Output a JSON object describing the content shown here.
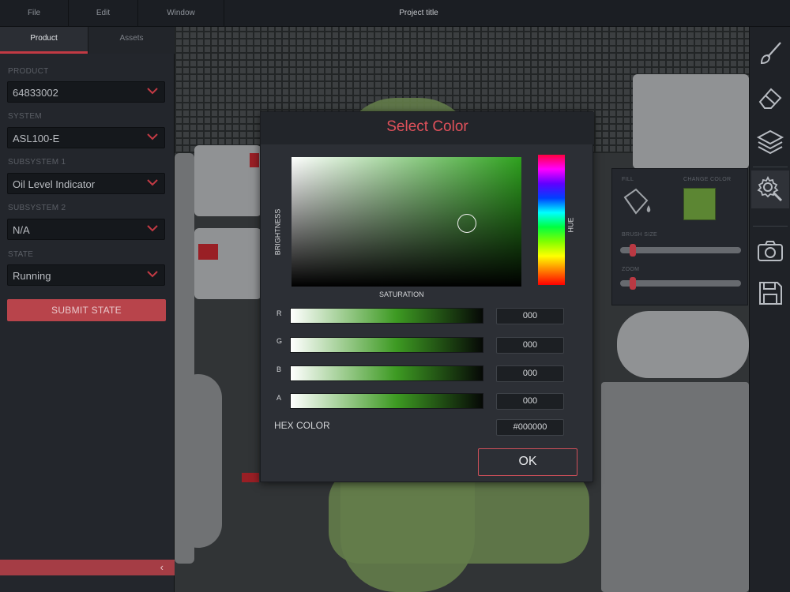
{
  "menubar": {
    "items": [
      "File",
      "Edit",
      "Window"
    ],
    "project_title": "Project title"
  },
  "left_panel": {
    "tabs": [
      "Product",
      "Assets"
    ],
    "active_tab": "Product",
    "fields": [
      {
        "label": "PRODUCT",
        "value": "64833002"
      },
      {
        "label": "SYSTEM",
        "value": "ASL100-E"
      },
      {
        "label": "SUBSYSTEM 1",
        "value": "Oil Level Indicator"
      },
      {
        "label": "SUBSYSTEM 2",
        "value": "N/A"
      },
      {
        "label": "STATE",
        "value": "Running"
      }
    ],
    "submit_label": "SUBMIT STATE",
    "collapse_arrow": "‹"
  },
  "dialog": {
    "title": "Select Color",
    "brightness_label": "BRIGHTNESS",
    "hue_label": "HUE",
    "saturation_label": "SATURATION",
    "channels": [
      {
        "label": "R",
        "value": "000"
      },
      {
        "label": "G",
        "value": "000"
      },
      {
        "label": "B",
        "value": "000"
      },
      {
        "label": "A",
        "value": "000"
      }
    ],
    "hex_label": "HEX COLOR",
    "hex_value": "#000000",
    "ok_label": "OK"
  },
  "brush_panel": {
    "fill_label": "FILL",
    "change_color_label": "CHANGE COLOR",
    "brush_size_label": "BRUSH SIZE",
    "zoom_label": "ZOOM",
    "swatch_color": "#5f8b33"
  },
  "right_toolbar": {
    "tools": [
      "brush-icon",
      "eraser-icon",
      "layers-icon",
      "settings-icon",
      "camera-icon",
      "save-icon"
    ],
    "active_tool": "settings-icon"
  },
  "colors": {
    "accent": "#c23a44",
    "panel": "#23262c",
    "dialog_title": "#e0515b"
  }
}
